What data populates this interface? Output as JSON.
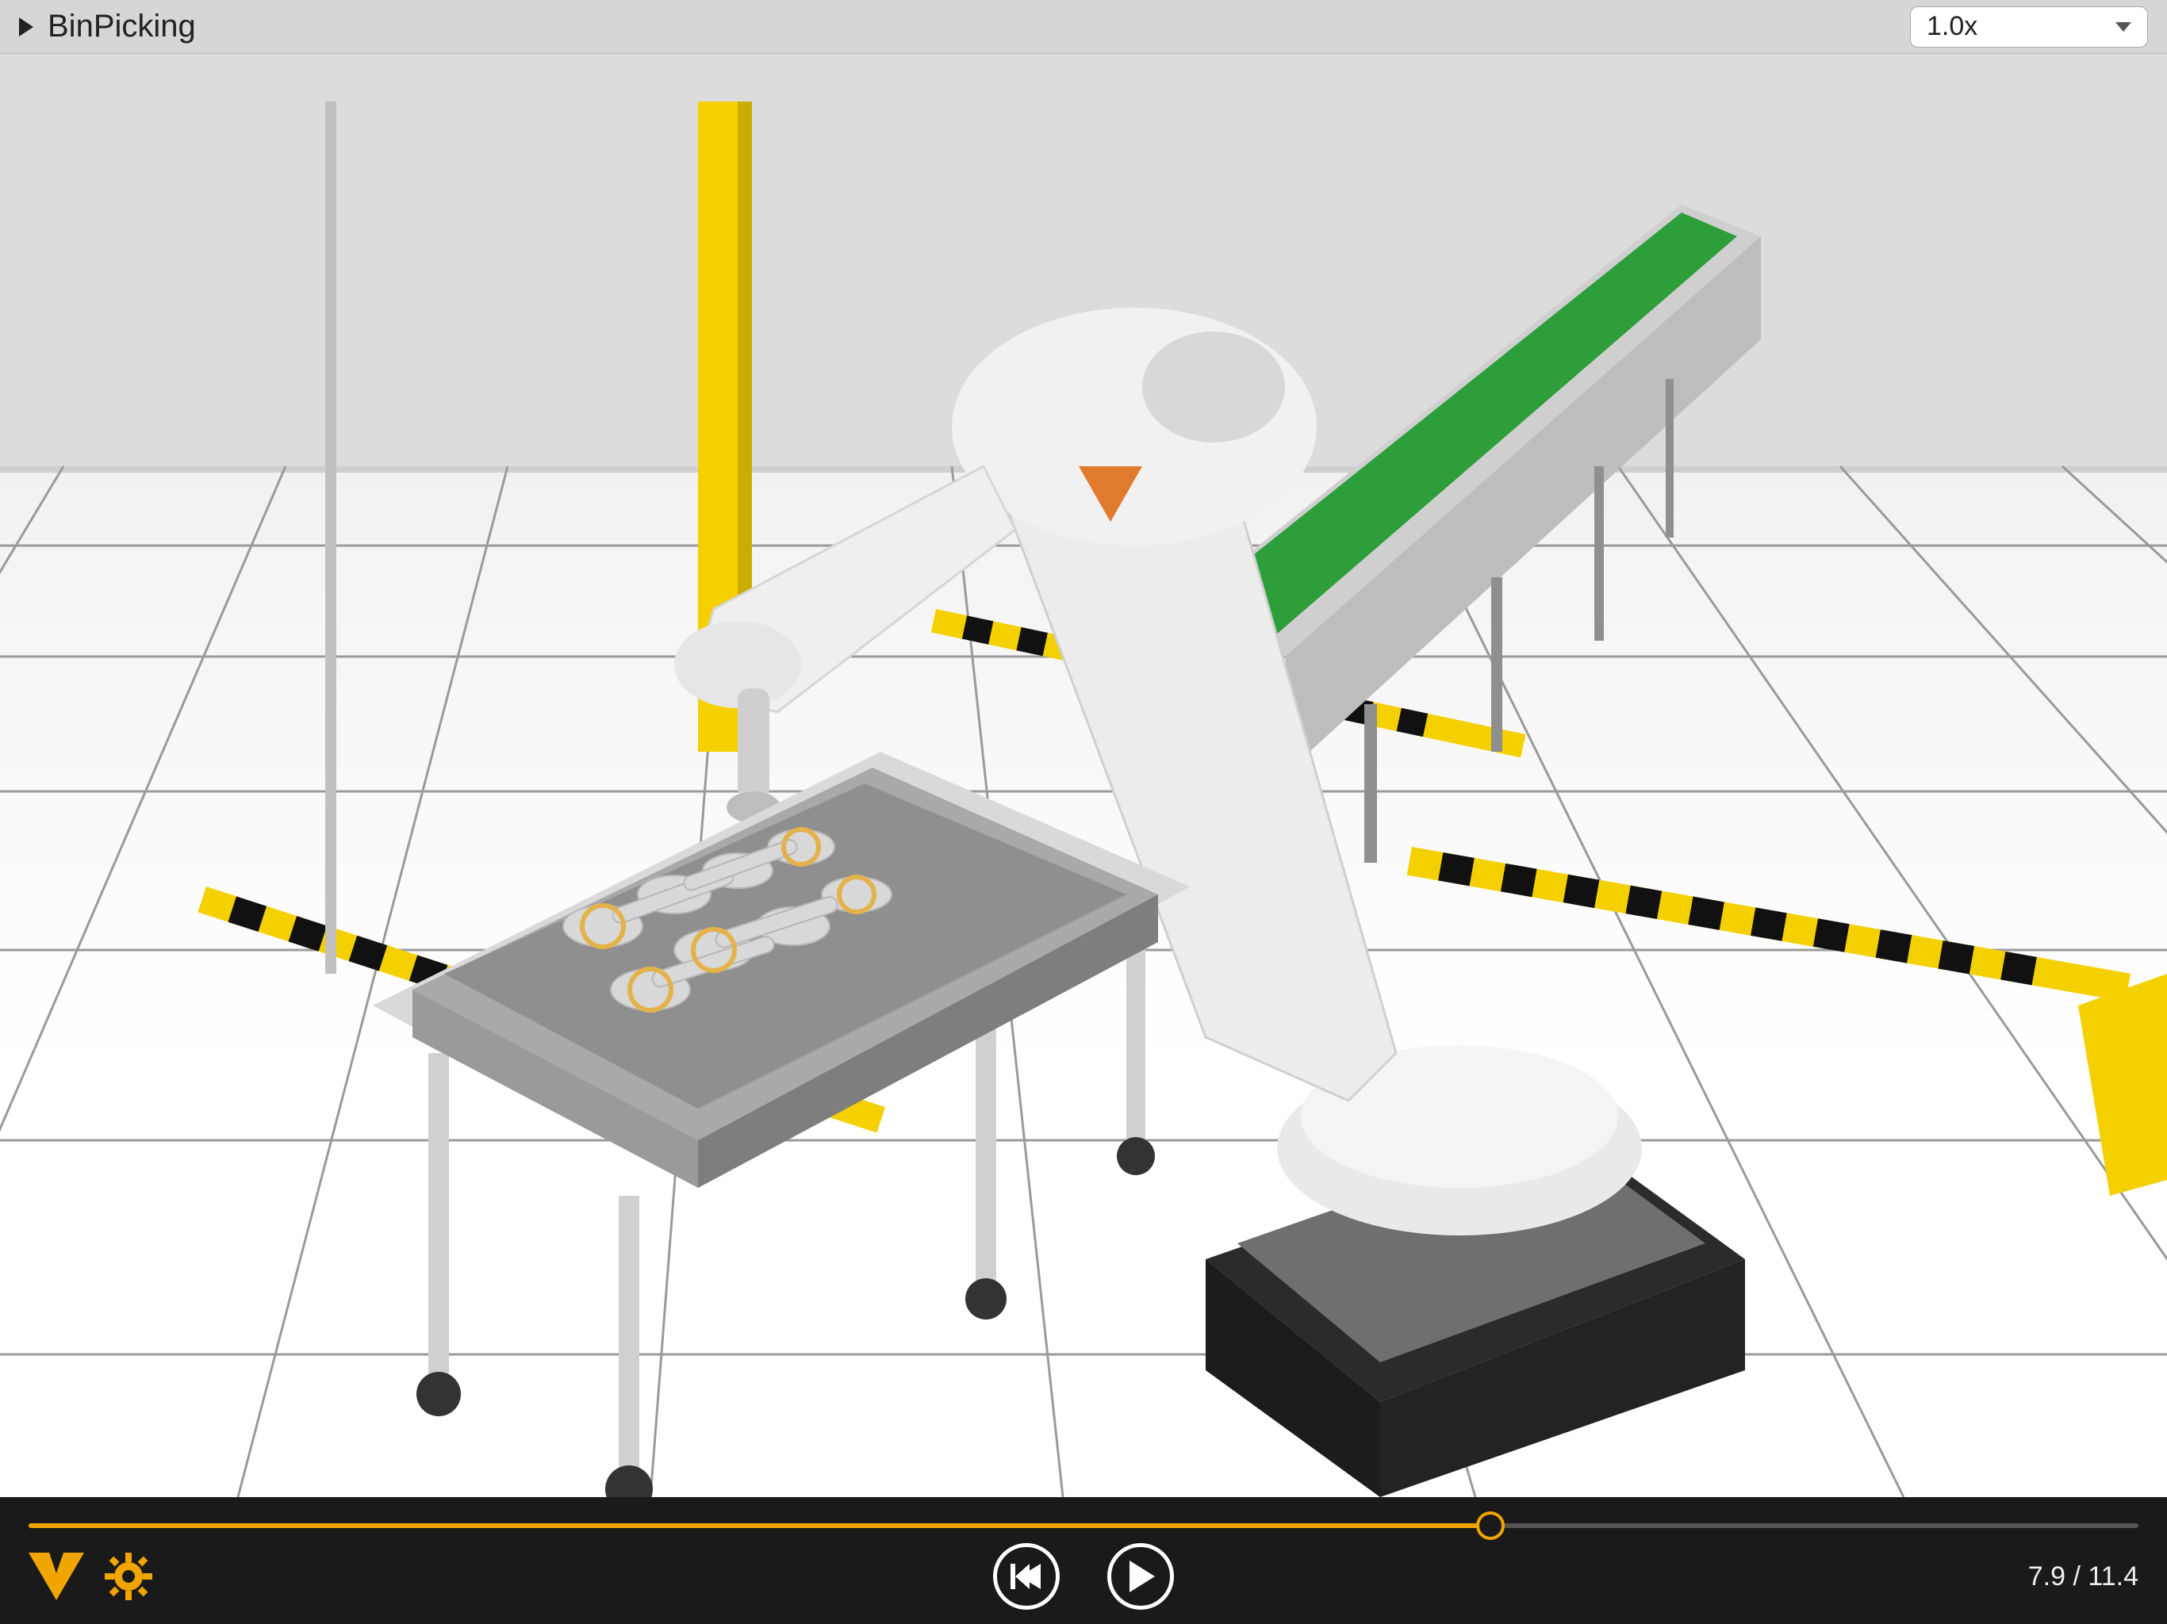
{
  "header": {
    "title": "BinPicking",
    "speed_label": "1.0x"
  },
  "playback": {
    "current_time": "7.9",
    "total_time": "11.4",
    "time_separator": " / ",
    "progress_pct": 69.3
  },
  "icons": {
    "expand": "play-triangle-icon",
    "speed_dropdown": "chevron-down-icon",
    "logo": "vortex-logo-icon",
    "settings": "gear-icon",
    "rewind": "skip-back-icon",
    "play": "play-icon"
  },
  "colors": {
    "accent": "#f0a500",
    "bar_bg": "#1a1a1a",
    "topbar_bg": "#d6d6d6"
  },
  "scene": {
    "description": "3D robotics simulation viewport: an industrial 6-axis robot arm on a dark pedestal reaches into a metal bin of connecting-rod parts on an aluminum-frame table; a green-belt conveyor extends to the upper right; yellow safety posts and black/yellow hazard tape mark the cell perimeter on a white tiled floor.",
    "objects": [
      "robot-arm",
      "robot-base-pedestal",
      "parts-bin",
      "connecting-rod-parts",
      "bin-table",
      "conveyor-belt",
      "safety-posts",
      "hazard-tape",
      "floor-grid"
    ]
  }
}
